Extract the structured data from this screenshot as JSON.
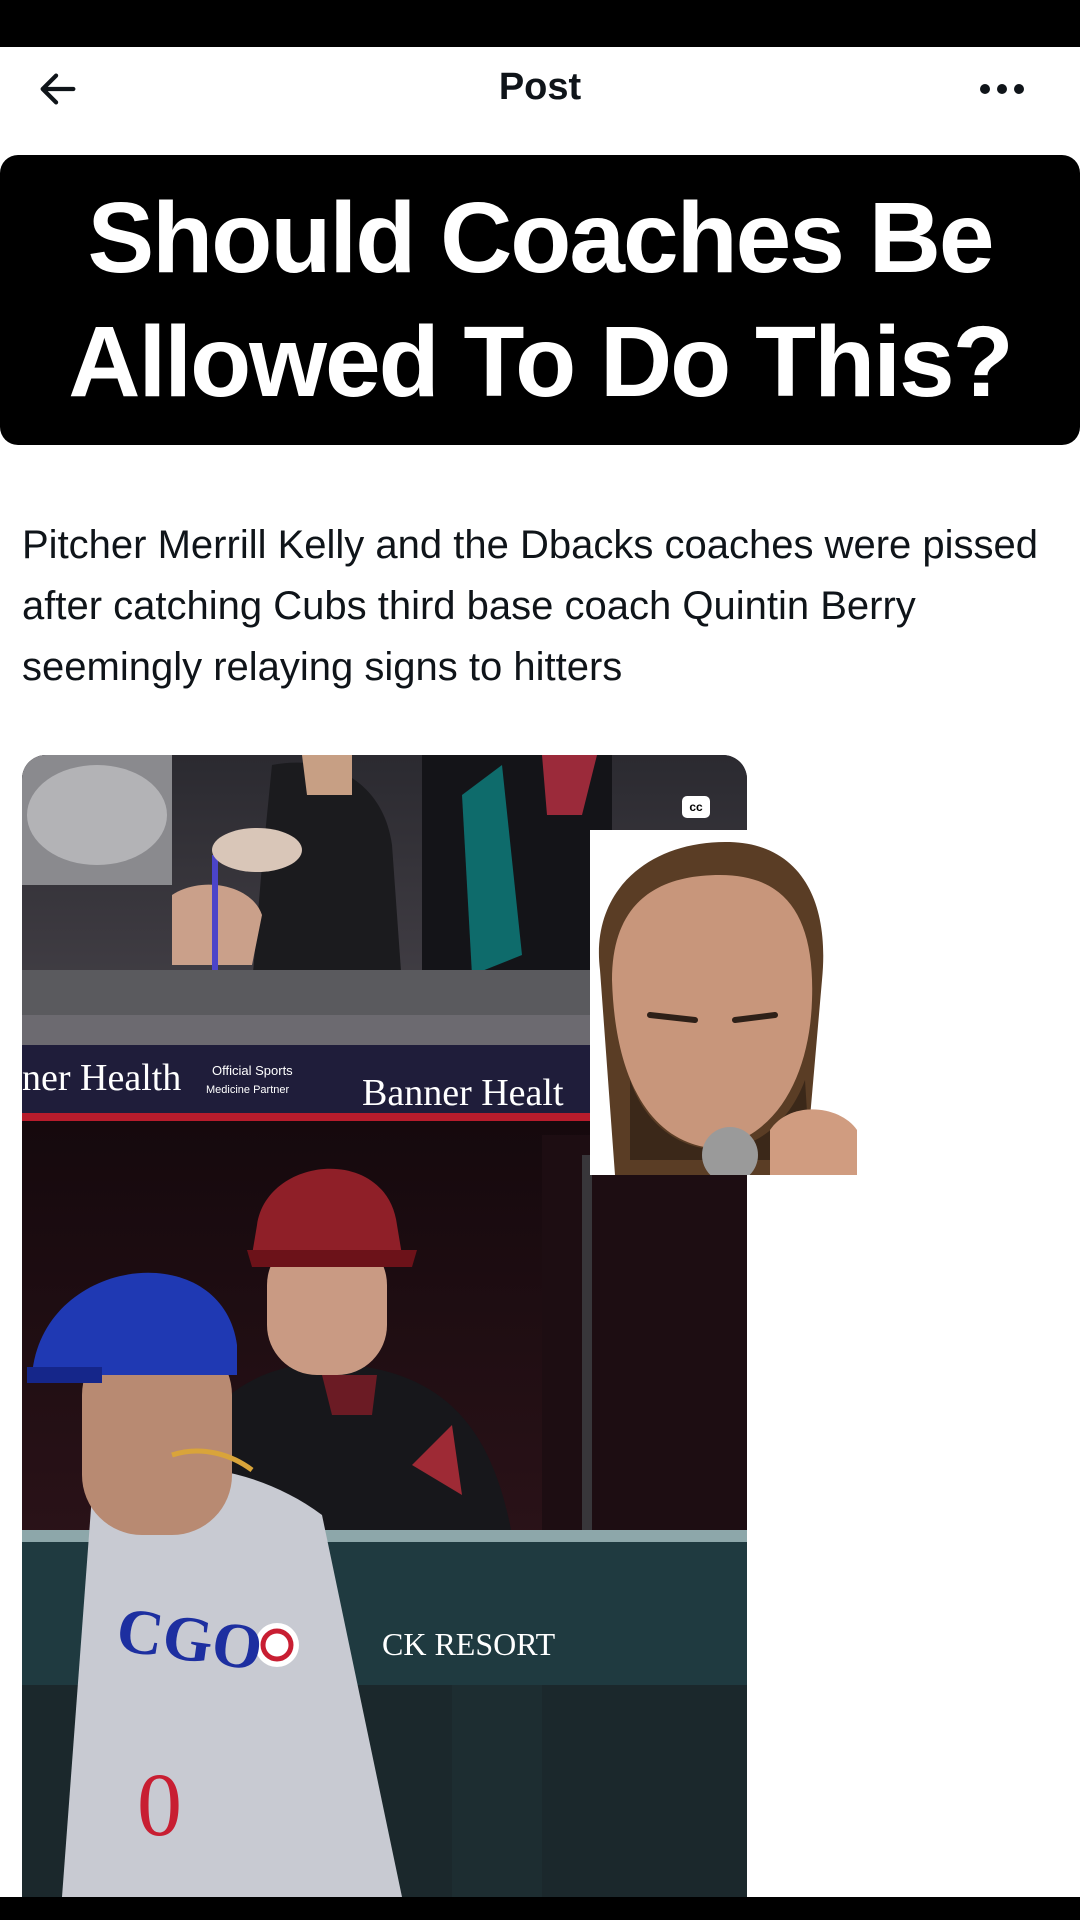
{
  "header": {
    "title": "Post",
    "back_icon": "arrow-left-icon",
    "more_icon": "more-horizontal-icon"
  },
  "headline": {
    "line1": "Should Coaches Be",
    "line2": "Allowed To Do This?"
  },
  "post": {
    "text": "Pitcher Merrill Kelly and the Dbacks coaches were pissed after catching Cubs third base coach Quintin Berry seemingly relaying signs to hitters"
  },
  "video": {
    "cc_label": "cc",
    "banner_left": "ner Health",
    "banner_small_1": "Official Sports",
    "banner_small_2": "Medicine Partner",
    "banner_right": "Banner Healt",
    "resort_text": "CK RESORT",
    "jersey_text": "CGO",
    "jersey_number": "0"
  },
  "colors": {
    "text": "#0f1419",
    "banner_bg": "#000000",
    "banner_text": "#ffffff"
  }
}
